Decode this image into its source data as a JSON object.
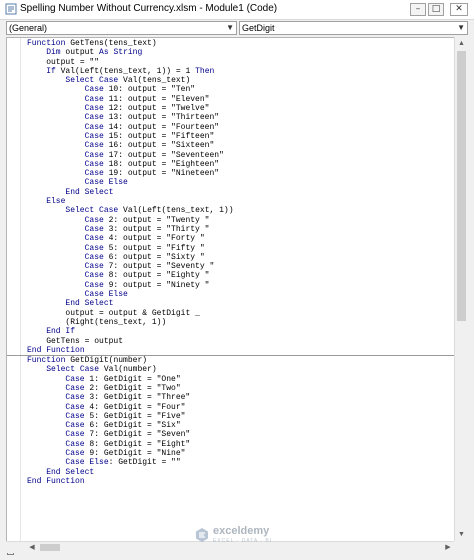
{
  "window": {
    "title": "Spelling Number Without Currency.xlsm - Module1 (Code)",
    "buttons": {
      "minimize": "–",
      "maximize": "□",
      "close": "✕"
    }
  },
  "toolbar": {
    "object_combo": "(General)",
    "procedure_combo": "GetDigit"
  },
  "code": {
    "lines": [
      "Function GetTens(tens_text)",
      "    Dim output As String",
      "    output = \"\"",
      "    If Val(Left(tens_text, 1)) = 1 Then",
      "        Select Case Val(tens_text)",
      "            Case 10: output = \"Ten\"",
      "            Case 11: output = \"Eleven\"",
      "            Case 12: output = \"Twelve\"",
      "            Case 13: output = \"Thirteen\"",
      "            Case 14: output = \"Fourteen\"",
      "            Case 15: output = \"Fifteen\"",
      "            Case 16: output = \"Sixteen\"",
      "            Case 17: output = \"Seventeen\"",
      "            Case 18: output = \"Eighteen\"",
      "            Case 19: output = \"Nineteen\"",
      "            Case Else",
      "        End Select",
      "    Else",
      "        Select Case Val(Left(tens_text, 1))",
      "            Case 2: output = \"Twenty \"",
      "            Case 3: output = \"Thirty \"",
      "            Case 4: output = \"Forty \"",
      "            Case 5: output = \"Fifty \"",
      "            Case 6: output = \"Sixty \"",
      "            Case 7: output = \"Seventy \"",
      "            Case 8: output = \"Eighty \"",
      "            Case 9: output = \"Ninety \"",
      "            Case Else",
      "        End Select",
      "        output = output & GetDigit _",
      "        (Right(tens_text, 1))",
      "    End If",
      "    GetTens = output",
      "End Function",
      "---SEPARATOR---",
      "Function GetDigit(number)",
      "    Select Case Val(number)",
      "        Case 1: GetDigit = \"One\"",
      "        Case 2: GetDigit = \"Two\"",
      "        Case 3: GetDigit = \"Three\"",
      "        Case 4: GetDigit = \"Four\"",
      "        Case 5: GetDigit = \"Five\"",
      "        Case 6: GetDigit = \"Six\"",
      "        Case 7: GetDigit = \"Seven\"",
      "        Case 8: GetDigit = \"Eight\"",
      "        Case 9: GetDigit = \"Nine\"",
      "        Case Else: GetDigit = \"\"",
      "    End Select",
      "End Function"
    ]
  },
  "watermark": {
    "brand": "exceldemy",
    "tagline": "EXCEL · DATA · BI"
  },
  "colors": {
    "keyword": "#00008b",
    "text": "#000000"
  }
}
